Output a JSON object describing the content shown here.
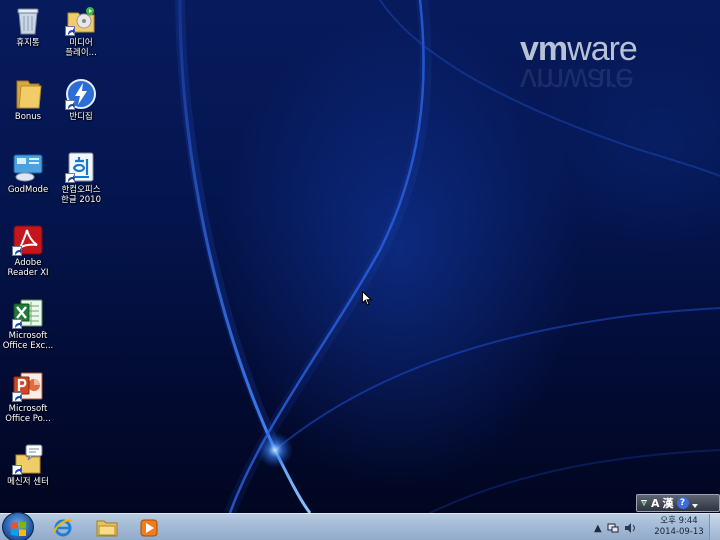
{
  "desktop": {
    "brand": {
      "vm": "vm",
      "ware": "ware"
    },
    "icons": [
      {
        "name": "recycle-bin",
        "label": "휴지통"
      },
      {
        "name": "media-player",
        "label": "미디어\n플레이..."
      },
      {
        "name": "bonus-folder",
        "label": "Bonus"
      },
      {
        "name": "bandizip",
        "label": "반디집"
      },
      {
        "name": "godmode",
        "label": "GodMode"
      },
      {
        "name": "hancom-office",
        "label": "한컴오피스\n한글 2010"
      },
      {
        "name": "adobe-reader",
        "label": "Adobe\nReader XI"
      },
      {
        "name": "excel",
        "label": "Microsoft\nOffice Exc..."
      },
      {
        "name": "powerpoint",
        "label": "Microsoft\nOffice Po..."
      },
      {
        "name": "messenger-center",
        "label": "메신저 센터"
      }
    ]
  },
  "language_bar": {
    "input_mode": "A",
    "hanja": "漢",
    "help": "?"
  },
  "taskbar": {
    "pinned": [
      "internet-explorer-icon",
      "explorer-folder-icon",
      "media-player-icon"
    ],
    "clock": {
      "time": "오후 9:44",
      "date": "2014-09-13"
    }
  },
  "colors": {
    "taskbar": "#a4bbd6",
    "wallpaper": "#04154e",
    "brand": "#b8c2d6"
  }
}
